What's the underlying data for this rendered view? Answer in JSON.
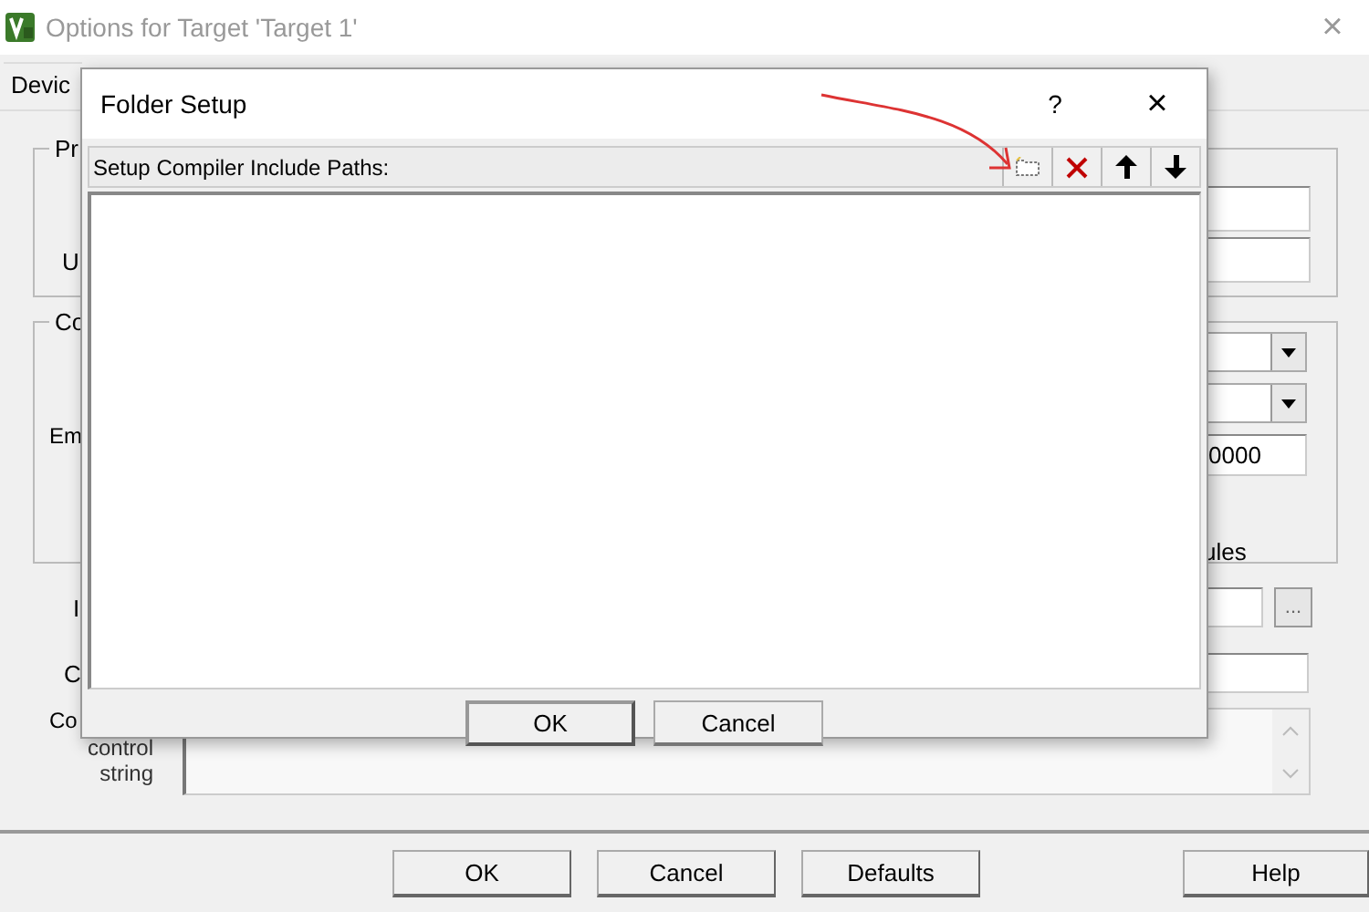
{
  "window": {
    "title": "Options for Target 'Target 1'",
    "close": "×"
  },
  "tabs": [
    {
      "label": "Devic",
      "selected": true
    }
  ],
  "group_1": {
    "label": "Pr",
    "row_label": "U"
  },
  "group_2": {
    "label": "Co",
    "row_label": "Em",
    "field_value": "0000",
    "trailing_text": "ules"
  },
  "rows": [
    {
      "kind": "browse",
      "label": "I",
      "button": "..."
    },
    {
      "kind": "field",
      "label": "C"
    },
    {
      "kind": "text_area",
      "label": "Co",
      "sublabel": "control\nstring"
    }
  ],
  "buttons": [
    {
      "label": "OK"
    },
    {
      "label": "Cancel"
    },
    {
      "label": "Defaults"
    },
    {
      "label": "Help"
    }
  ],
  "folder_setup": {
    "title": "Folder Setup",
    "help": "?",
    "close": "×",
    "heading": "Setup Compiler Include Paths:",
    "tools": [
      {
        "kind": "new"
      },
      {
        "kind": "delete"
      },
      {
        "kind": "up"
      },
      {
        "kind": "down"
      }
    ],
    "buttons": [
      {
        "label": "OK",
        "default": true
      },
      {
        "label": "Cancel",
        "default": false
      }
    ]
  }
}
